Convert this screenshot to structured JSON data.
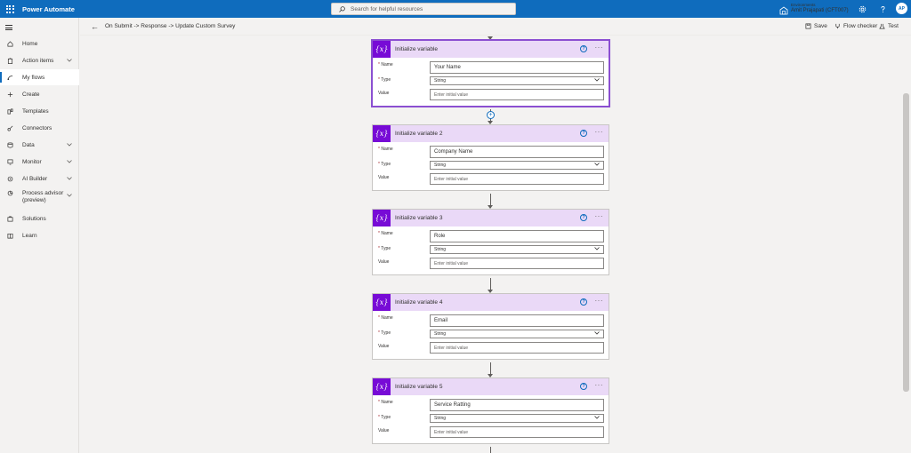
{
  "app": {
    "title": "Power Automate"
  },
  "search": {
    "placeholder": "Search for helpful resources"
  },
  "environment": {
    "label": "Environments",
    "name": "Amit Prajapati (CFT007)"
  },
  "user": {
    "initials": "AP"
  },
  "sidebar": {
    "items": [
      {
        "label": "Home",
        "icon": "home-icon",
        "chevron": false
      },
      {
        "label": "Action items",
        "icon": "clipboard-icon",
        "chevron": true
      },
      {
        "label": "My flows",
        "icon": "flows-icon",
        "chevron": false,
        "active": true
      },
      {
        "label": "Create",
        "icon": "plus-icon",
        "chevron": false
      },
      {
        "label": "Templates",
        "icon": "templates-icon",
        "chevron": false
      },
      {
        "label": "Connectors",
        "icon": "connectors-icon",
        "chevron": false
      },
      {
        "label": "Data",
        "icon": "data-icon",
        "chevron": true
      },
      {
        "label": "Monitor",
        "icon": "monitor-icon",
        "chevron": true
      },
      {
        "label": "AI Builder",
        "icon": "ai-builder-icon",
        "chevron": true
      },
      {
        "label": "Process advisor (preview)",
        "icon": "process-advisor-icon",
        "chevron": true
      },
      {
        "label": "Solutions",
        "icon": "solutions-icon",
        "chevron": false
      },
      {
        "label": "Learn",
        "icon": "learn-icon",
        "chevron": false
      }
    ]
  },
  "commandbar": {
    "breadcrumb": "On Submit -> Response -> Update Custom Survey",
    "save": "Save",
    "flow_checker": "Flow checker",
    "test": "Test"
  },
  "fields": {
    "name_label": "Name",
    "type_label": "Type",
    "value_label": "Value",
    "required_mark": "*"
  },
  "cards": [
    {
      "title": "Initialize variable",
      "name": "Your Name",
      "type": "String",
      "value_placeholder": "Enter initial value",
      "selected": true
    },
    {
      "title": "Initialize variable 2",
      "name": "Company Name",
      "type": "String",
      "value_placeholder": "Enter initial value"
    },
    {
      "title": "Initialize variable 3",
      "name": "Role",
      "type": "String",
      "value_placeholder": "Enter initial value"
    },
    {
      "title": "Initialize variable 4",
      "name": "Email",
      "type": "String",
      "value_placeholder": "Enter initial value"
    },
    {
      "title": "Initialize variable 5",
      "name": "Service Ratting",
      "type": "String",
      "value_placeholder": "Enter initial value"
    }
  ],
  "icons": {
    "var": "{x}",
    "help": "?",
    "more": "···",
    "back": "←"
  },
  "colors": {
    "brand": "#0f6cbd",
    "variable_accent": "#770bd6",
    "card_header": "#ead9f7"
  }
}
